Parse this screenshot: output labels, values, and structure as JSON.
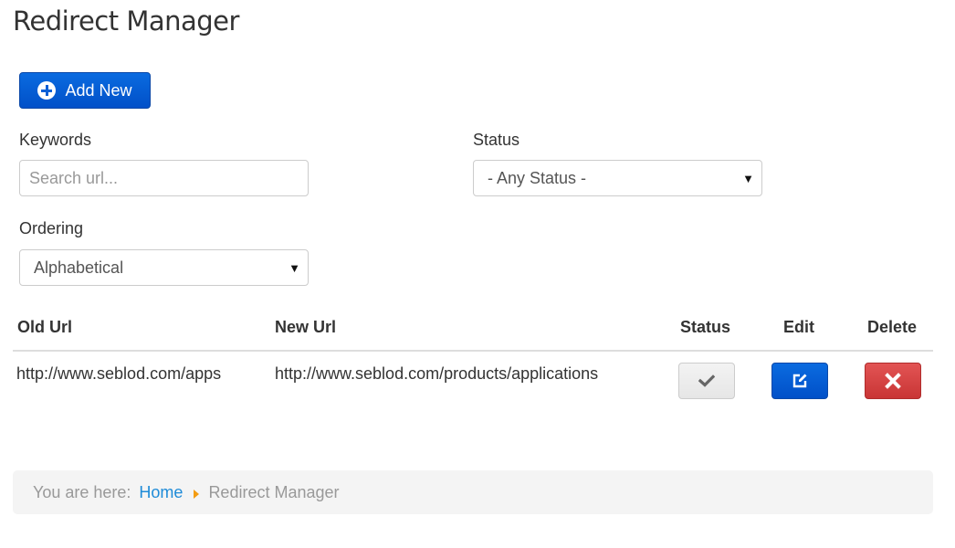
{
  "page": {
    "title": "Redirect Manager"
  },
  "toolbar": {
    "add_new_label": "Add New",
    "add_new_icon": "plus-circle-icon"
  },
  "filters": {
    "keywords": {
      "label": "Keywords",
      "value": "",
      "placeholder": "Search url..."
    },
    "status": {
      "label": "Status",
      "selected": "- Any Status -"
    },
    "ordering": {
      "label": "Ordering",
      "selected": "Alphabetical"
    }
  },
  "table": {
    "columns": [
      "Old Url",
      "New Url",
      "Status",
      "Edit",
      "Delete"
    ],
    "rows": [
      {
        "old_url": "http://www.seblod.com/apps",
        "new_url": "http://www.seblod.com/products/applications",
        "status_icon": "check-icon",
        "edit_icon": "edit-icon",
        "delete_icon": "close-icon"
      }
    ]
  },
  "breadcrumb": {
    "prefix": "You are here:",
    "items": [
      {
        "label": "Home",
        "link": true
      },
      {
        "label": "Redirect Manager",
        "link": false
      }
    ]
  },
  "colors": {
    "primary": "#0150c8",
    "danger": "#c93535",
    "link": "#1e8bd8",
    "breadcrumb_separator": "#f39c12"
  }
}
